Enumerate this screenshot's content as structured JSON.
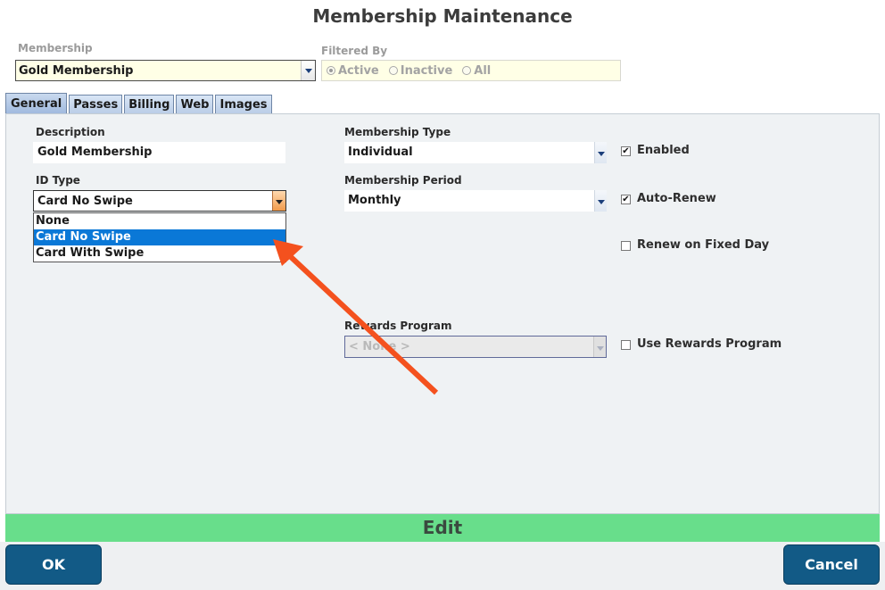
{
  "window": {
    "title": "Membership Maintenance"
  },
  "membership": {
    "label": "Membership",
    "selected": "Gold Membership"
  },
  "filter": {
    "label": "Filtered By",
    "options": [
      {
        "label": "Active",
        "selected": true
      },
      {
        "label": "Inactive",
        "selected": false
      },
      {
        "label": "All",
        "selected": false
      }
    ]
  },
  "tabs": [
    {
      "label": "General",
      "active": true
    },
    {
      "label": "Passes",
      "active": false
    },
    {
      "label": "Billing",
      "active": false
    },
    {
      "label": "Web",
      "active": false
    },
    {
      "label": "Images",
      "active": false
    }
  ],
  "general": {
    "description": {
      "label": "Description",
      "value": "Gold Membership"
    },
    "id_type": {
      "label": "ID Type",
      "value": "Card No Swipe",
      "options": [
        "None",
        "Card No Swipe",
        "Card With Swipe"
      ],
      "highlighted_index": 1
    },
    "membership_type": {
      "label": "Membership Type",
      "value": "Individual"
    },
    "membership_period": {
      "label": "Membership Period",
      "value": "Monthly"
    },
    "rewards_program": {
      "label": "Rewards Program",
      "value": "< None >"
    },
    "checkboxes": {
      "enabled": {
        "label": "Enabled",
        "checked": true
      },
      "auto_renew": {
        "label": "Auto-Renew",
        "checked": true
      },
      "renew_fixed_day": {
        "label": "Renew on Fixed Day",
        "checked": false
      },
      "use_rewards": {
        "label": "Use Rewards Program",
        "checked": false
      }
    }
  },
  "status_bar": {
    "mode": "Edit"
  },
  "buttons": {
    "ok": "OK",
    "cancel": "Cancel"
  },
  "colors": {
    "edit_bar": "#68de8b",
    "button": "#125a86",
    "annotation_arrow": "#f4511e",
    "selection": "#0a78d7"
  }
}
